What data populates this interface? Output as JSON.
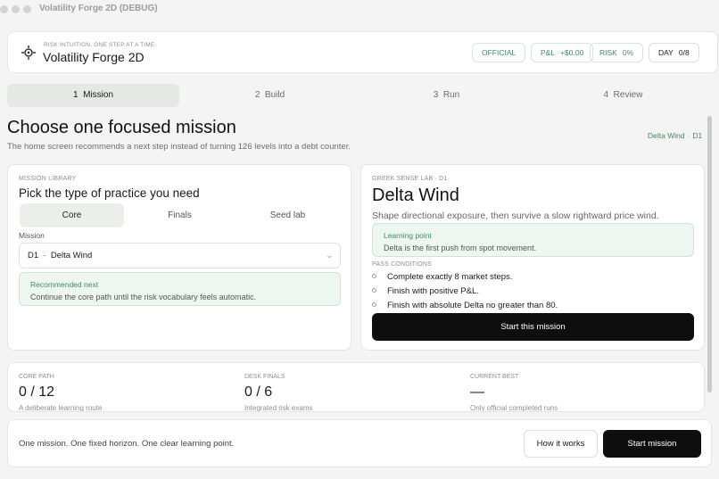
{
  "window": {
    "title": "Volatility Forge 2D (DEBUG)"
  },
  "header": {
    "tagline": "RISK INTUITION, ONE STEP AT A TIME",
    "app_name": "Volatility Forge 2D",
    "pills": [
      {
        "label": "OFFICIAL",
        "value": ""
      },
      {
        "label": "P&L",
        "value": "+$0.00"
      },
      {
        "label": "RISK",
        "value": "0%"
      },
      {
        "label": "DAY",
        "value": "0/8"
      }
    ]
  },
  "steps": [
    {
      "num": "1",
      "label": "Mission",
      "active": true
    },
    {
      "num": "2",
      "label": "Build",
      "active": false
    },
    {
      "num": "3",
      "label": "Run",
      "active": false
    },
    {
      "num": "4",
      "label": "Review",
      "active": false
    }
  ],
  "page": {
    "title": "Choose one focused mission",
    "subtitle": "The home screen recommends a next step instead of turning 126 levels into a debt counter.",
    "crumb_a": "Delta Wind",
    "crumb_sep": "·",
    "crumb_b": "D1"
  },
  "library": {
    "kicker": "MISSION LIBRARY",
    "title": "Pick the type of practice you need",
    "tabs": [
      "Core",
      "Finals",
      "Seed lab"
    ],
    "mission_label": "Mission",
    "selected_mission": "D1  ·  Delta Wind",
    "note_title": "Recommended next",
    "note_body": "Continue the core path until the risk vocabulary feels automatic."
  },
  "detail": {
    "kicker": "GREEK SENSE LAB  ·  D1",
    "title": "Delta Wind",
    "subtitle": "Shape directional exposure, then survive a slow rightward price wind.",
    "learning_title": "Learning point",
    "learning_body": "Delta is the first push from spot movement.",
    "pass_kicker": "PASS CONDITIONS",
    "conditions": [
      "Complete exactly 8 market steps.",
      "Finish with positive P&L.",
      "Finish with absolute Delta no greater than 80."
    ],
    "start_label": "Start this mission"
  },
  "stats": [
    {
      "label": "CORE PATH",
      "value": "0 / 12",
      "sub": "A deliberate learning route"
    },
    {
      "label": "DESK FINALS",
      "value": "0 / 6",
      "sub": "Integrated risk exams"
    },
    {
      "label": "CURRENT BEST",
      "value": "—",
      "sub": "Only official completed runs"
    }
  ],
  "footer": {
    "text": "One mission. One fixed horizon. One clear learning point.",
    "how_label": "How it works",
    "start_label": "Start mission"
  },
  "colors": {
    "accent": "#3f8a63",
    "dark": "#0e0e0e",
    "note_bg": "#eef6f0"
  },
  "icons": {
    "logo": "crosshair-icon",
    "select": "chevron-down-icon",
    "condition": "ring-bullet-icon"
  }
}
